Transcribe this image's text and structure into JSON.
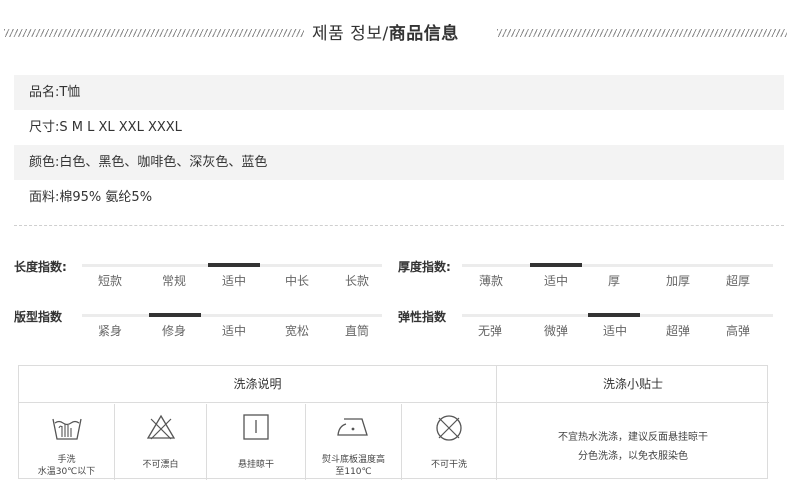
{
  "header": {
    "title_ko": "제품 정보/",
    "title_zh": "商品信息"
  },
  "info": [
    {
      "label": "品名:",
      "value": "T恤"
    },
    {
      "label": "尺寸:",
      "value": "S M L XL XXL XXXL"
    },
    {
      "label": "颜色:",
      "value": "白色、黑色、咖啡色、深灰色、蓝色"
    },
    {
      "label": "面料:",
      "value": "棉95% 氨纶5%"
    }
  ],
  "scales": [
    {
      "label": "长度指数:",
      "options": [
        "短款",
        "常规",
        "适中",
        "中长",
        "长款"
      ],
      "selected": "适中"
    },
    {
      "label": "厚度指数:",
      "options": [
        "薄款",
        "适中",
        "厚",
        "加厚",
        "超厚"
      ],
      "selected": "适中"
    },
    {
      "label": "版型指数",
      "options": [
        "紧身",
        "修身",
        "适中",
        "宽松",
        "直筒"
      ],
      "selected": "修身"
    },
    {
      "label": "弹性指数",
      "options": [
        "无弹",
        "微弹",
        "适中",
        "超弹",
        "高弹"
      ],
      "selected": "适中"
    }
  ],
  "washing": {
    "title": "洗涤说明",
    "tips_title": "洗涤小贴士",
    "items": [
      {
        "icon": "hand-wash-icon",
        "line1": "手洗",
        "line2": "水温30℃以下"
      },
      {
        "icon": "no-bleach-icon",
        "line1": "不可漂白",
        "line2": ""
      },
      {
        "icon": "hang-dry-icon",
        "line1": "悬挂晾干",
        "line2": ""
      },
      {
        "icon": "iron-icon",
        "line1": "熨斗底板温度高",
        "line2": "至110℃"
      },
      {
        "icon": "no-dry-clean-icon",
        "line1": "不可干洗",
        "line2": ""
      }
    ],
    "tips": [
      "不宜热水洗涤，建议反面悬挂晾干",
      "分色洗涤，以免衣服染色"
    ]
  }
}
